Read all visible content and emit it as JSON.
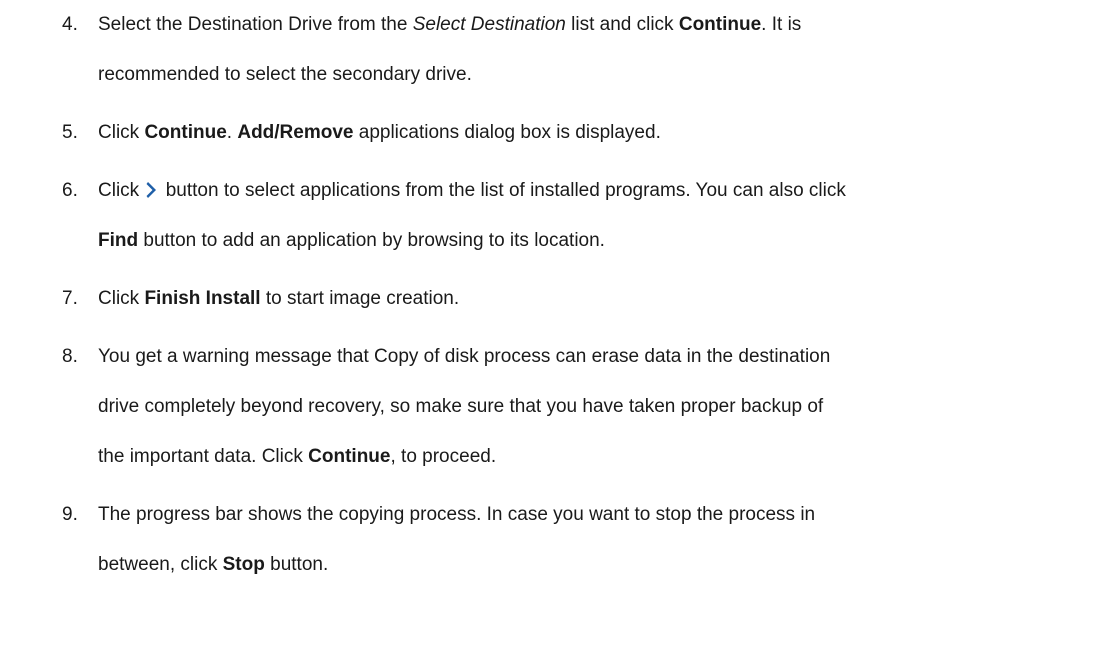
{
  "steps": [
    {
      "number": "4.",
      "lines": [
        [
          {
            "t": "Select the Destination Drive from the "
          },
          {
            "t": "Select Destination",
            "i": true
          },
          {
            "t": " list and click "
          },
          {
            "t": "Continue",
            "b": true
          },
          {
            "t": ". It is"
          }
        ],
        [
          {
            "t": "recommended to select the secondary drive."
          }
        ]
      ]
    },
    {
      "number": "5.",
      "lines": [
        [
          {
            "t": "Click "
          },
          {
            "t": "Continue",
            "b": true
          },
          {
            "t": ". "
          },
          {
            "t": "Add/Remove",
            "b": true
          },
          {
            "t": " applications dialog box is displayed."
          }
        ]
      ]
    },
    {
      "number": "6.",
      "lines": [
        [
          {
            "t": "Click "
          },
          {
            "icon": "chevron-right-icon"
          },
          {
            "t": " button to select applications from the list of installed programs. You can also click"
          }
        ],
        [
          {
            "t": "Find",
            "b": true
          },
          {
            "t": " button to add an application by browsing to its location."
          }
        ]
      ]
    },
    {
      "number": "7.",
      "lines": [
        [
          {
            "t": "Click "
          },
          {
            "t": "Finish Install",
            "b": true
          },
          {
            "t": " to start image creation."
          }
        ]
      ]
    },
    {
      "number": "8.",
      "lines": [
        [
          {
            "t": "You get a warning message that Copy of disk process can erase data in the destination"
          }
        ],
        [
          {
            "t": "drive completely beyond recovery, so make sure that you have taken proper backup of"
          }
        ],
        [
          {
            "t": "the important data. Click "
          },
          {
            "t": "Continue",
            "b": true
          },
          {
            "t": ", to proceed."
          }
        ]
      ]
    },
    {
      "number": "9.",
      "lines": [
        [
          {
            "t": "The progress bar shows the copying process. In case you want to stop the process in"
          }
        ],
        [
          {
            "t": "between, click "
          },
          {
            "t": "Stop",
            "b": true
          },
          {
            "t": " button."
          }
        ]
      ]
    }
  ],
  "icon_color": "#1f5fa8"
}
